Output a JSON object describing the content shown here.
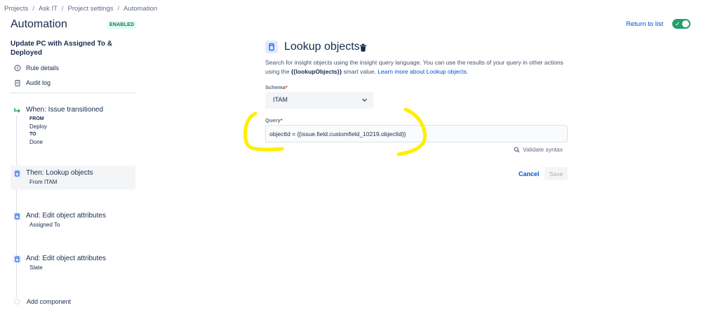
{
  "breadcrumb": [
    "Projects",
    "Ask IT",
    "Project settings",
    "Automation"
  ],
  "page_title": "Automation",
  "status_badge": "ENABLED",
  "return_link": "Return to list",
  "rule": {
    "name": "Update PC with Assigned To & Deployed",
    "links": [
      {
        "label": "Rule details",
        "icon": "info-icon"
      },
      {
        "label": "Audit log",
        "icon": "clipboard-icon"
      }
    ]
  },
  "steps": [
    {
      "title": "When: Issue transitioned",
      "icon": "transition-icon",
      "lines": [
        {
          "text": "FROM",
          "bold": true
        },
        {
          "text": "Deploy",
          "bold": false
        },
        {
          "text": "TO",
          "bold": true
        },
        {
          "text": "Done",
          "bold": false
        }
      ]
    },
    {
      "title": "Then: Lookup objects",
      "icon": "insight-object-icon",
      "lines": [
        {
          "text": "From ITAM",
          "bold": false
        }
      ]
    },
    {
      "title": "And: Edit object attributes",
      "icon": "insight-object-icon",
      "lines": [
        {
          "text": "Assigned To",
          "bold": false
        }
      ]
    },
    {
      "title": "And: Edit object attributes",
      "icon": "insight-object-icon",
      "lines": [
        {
          "text": "State",
          "bold": false
        }
      ]
    }
  ],
  "add_component": "Add component",
  "panel": {
    "title": "Lookup objects",
    "description_pre": "Search for insight objects using the insight query language. You can use the results of your query in other actions using the ",
    "description_bold": "{{lookupObjects}}",
    "description_post": " smart value. ",
    "description_link": "Learn more about Lookup objects.",
    "schema_label": "Schema",
    "schema_value": "ITAM",
    "query_label": "Query",
    "query_value": "objectId = {{issue.field.customfield_10219.objectId}}",
    "validate": "Validate syntax",
    "cancel": "Cancel",
    "save": "Save"
  },
  "colors": {
    "accent": "#0052cc",
    "toggle_on": "#22a06b",
    "highlight": "#ffee00"
  }
}
